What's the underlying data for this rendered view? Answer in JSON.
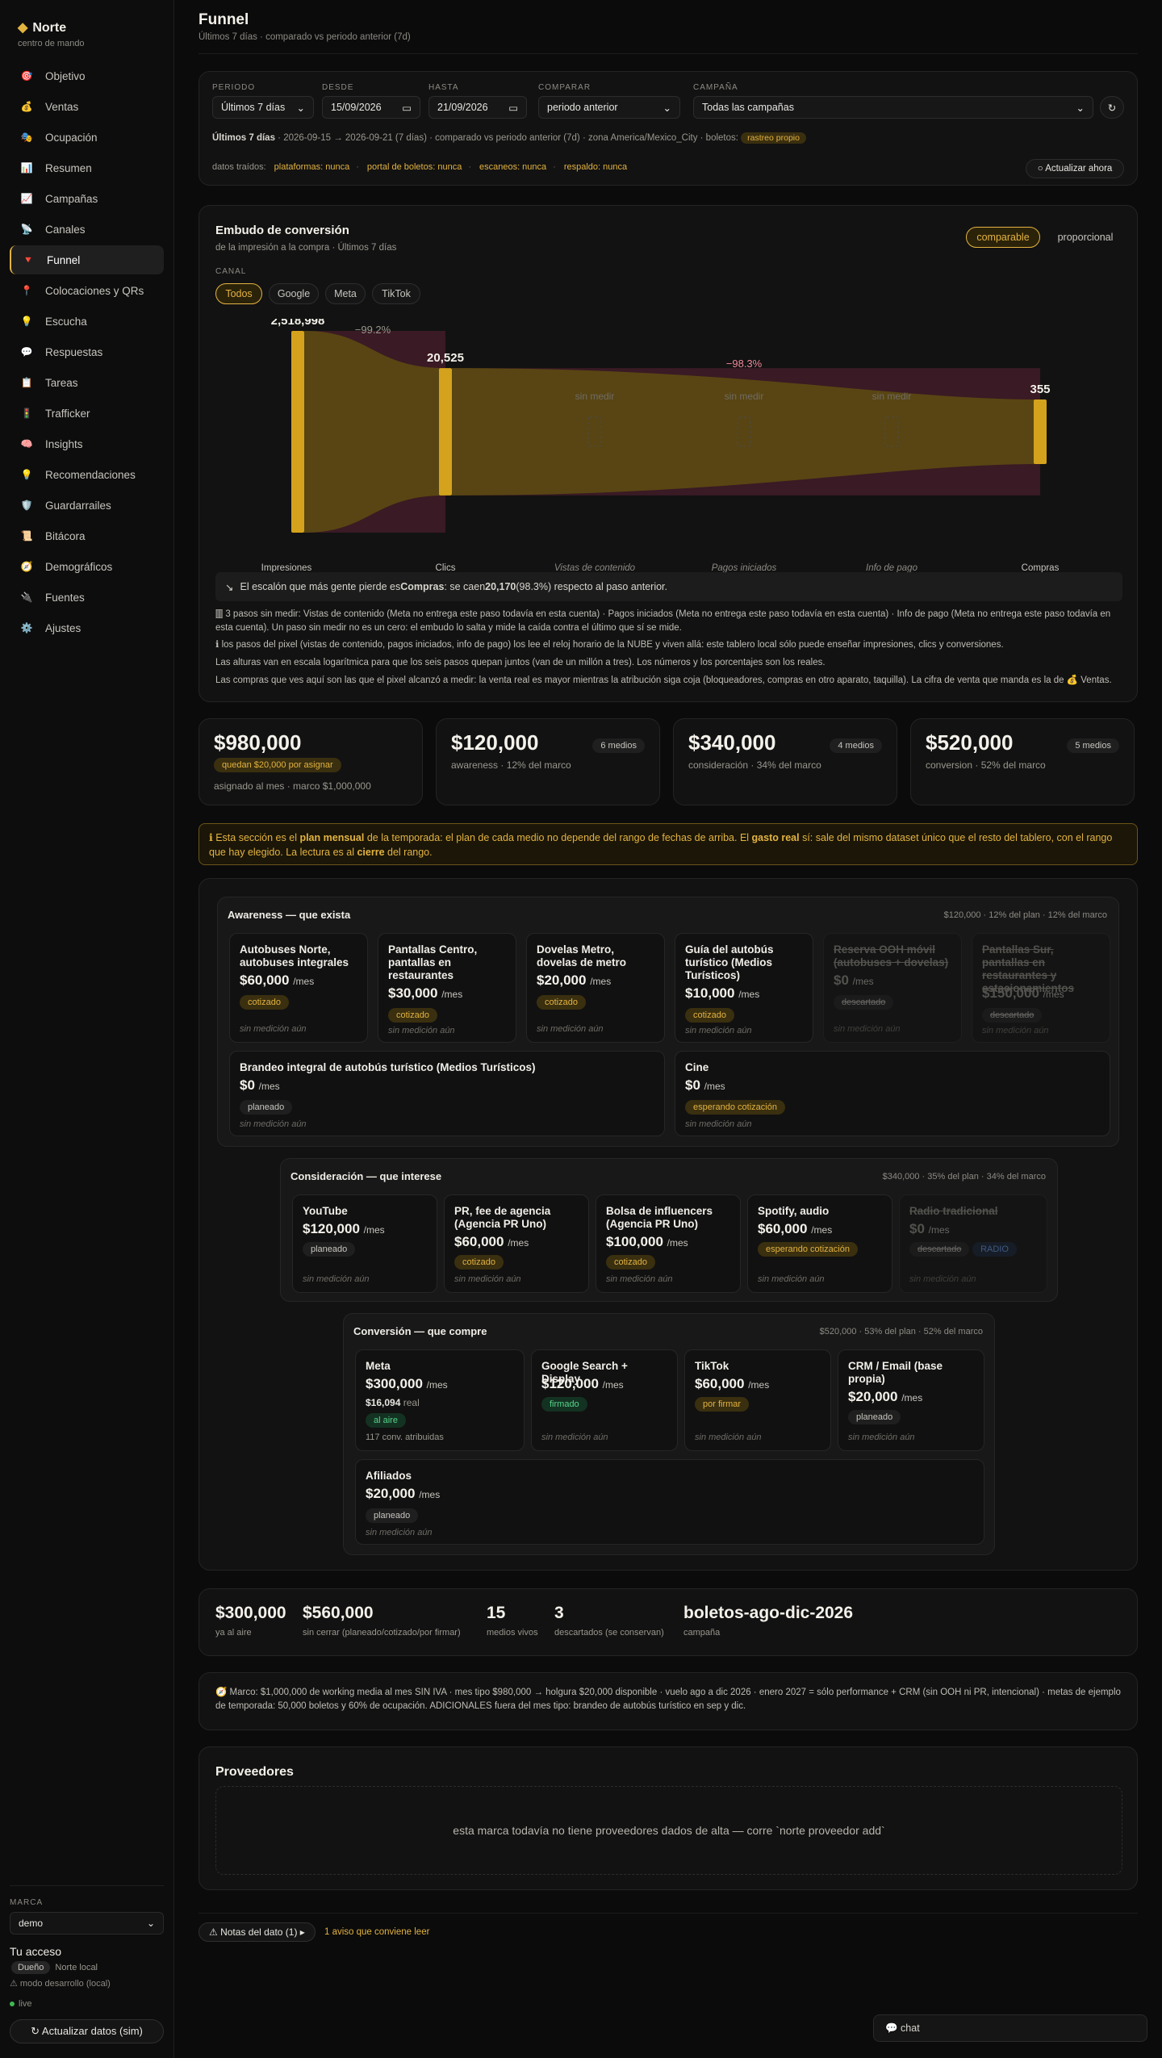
{
  "sidebar": {
    "brand": "Norte",
    "brand_sub": "centro de mando",
    "items": [
      {
        "icon": "🎯",
        "label": "Objetivo"
      },
      {
        "icon": "💰",
        "label": "Ventas"
      },
      {
        "icon": "🎭",
        "label": "Ocupación"
      },
      {
        "icon": "📊",
        "label": "Resumen"
      },
      {
        "icon": "📈",
        "label": "Campañas"
      },
      {
        "icon": "📡",
        "label": "Canales"
      },
      {
        "icon": "🔻",
        "label": "Funnel"
      },
      {
        "icon": "📍",
        "label": "Colocaciones y QRs"
      },
      {
        "icon": "💡",
        "label": "Escucha"
      },
      {
        "icon": "💬",
        "label": "Respuestas"
      },
      {
        "icon": "📋",
        "label": "Tareas"
      },
      {
        "icon": "🚦",
        "label": "Trafficker"
      },
      {
        "icon": "🧠",
        "label": "Insights"
      },
      {
        "icon": "💡",
        "label": "Recomendaciones"
      },
      {
        "icon": "🛡️",
        "label": "Guardarrailes"
      },
      {
        "icon": "📜",
        "label": "Bitácora"
      },
      {
        "icon": "🧭",
        "label": "Demográficos"
      },
      {
        "icon": "🔌",
        "label": "Fuentes"
      },
      {
        "icon": "⚙️",
        "label": "Ajustes"
      }
    ],
    "active": "Funnel",
    "marca_label": "MARCA",
    "marca_value": "demo",
    "acceso_title": "Tu acceso",
    "role": "Dueño",
    "role_name": "Norte local",
    "dev_mode": "⚠ modo desarrollo (local)",
    "live": "live",
    "update_button": "↻ Actualizar datos (sim)"
  },
  "header": {
    "title": "Funnel",
    "subtitle": "Últimos 7 días · comparado vs periodo anterior (7d)"
  },
  "filters": {
    "periodo_label": "PERIODO",
    "periodo": "Últimos 7 días",
    "desde_label": "DESDE",
    "desde": "15/09/2026",
    "hasta_label": "HASTA",
    "hasta": "21/09/2026",
    "comparar_label": "COMPARAR",
    "comparar": "periodo anterior",
    "campana_label": "CAMPAÑA",
    "campana": "Todas las campañas",
    "refresh_icon": "↻",
    "range_strong": "Últimos 7 días",
    "range_text": " · 2026-09-15 → 2026-09-21 (7 días) · comparado vs periodo anterior (7d) · zona America/Mexico_City · boletos:",
    "boletos_chip": "rastreo propio",
    "fetched_label": "datos traídos:",
    "fetched": [
      "plataformas: nunca",
      "portal de boletos: nunca",
      "escaneos: nunca",
      "respaldo: nunca"
    ],
    "update_now": "○ Actualizar ahora"
  },
  "funnel": {
    "title": "Embudo de conversión",
    "subtitle": "de la impresión a la compra · Últimos 7 días",
    "mode_a": "comparable",
    "mode_b": "proporcional",
    "canal_label": "CANAL",
    "channels": [
      "Todos",
      "Google",
      "Meta",
      "TikTok"
    ],
    "active_channel": "Todos",
    "drop1": "−99.2%",
    "drop2": "−98.3%",
    "no_measure": "sin medir",
    "warn": "El escalón que más gente pierde es Compras: se caen 20,170 (98.3%) respecto al paso anterior.",
    "notes": [
      "3 pasos sin medir: Vistas de contenido (Meta no entrega este paso todavía en esta cuenta) · Pagos iniciados (Meta no entrega este paso todavía en esta cuenta) · Info de pago (Meta no entrega este paso todavía en esta cuenta). Un paso sin medir no es un cero: el embudo lo salta y mide la caída contra el último que sí se mide.",
      "ℹ los pasos del pixel (vistas de contenido, pagos iniciados, info de pago) los lee el reloj horario de la NUBE y viven allá: este tablero local sólo puede enseñar impresiones, clics y conversiones.",
      "Las alturas van en escala logarítmica para que los seis pasos quepan juntos (van de un millón a tres). Los números y los porcentajes son los reales.",
      "Las compras que ves aquí son las que el pixel alcanzó a medir: la venta real es mayor mientras la atribución siga coja (bloqueadores, compras en otro aparato, taquilla). La cifra de venta que manda es la de 💰 Ventas."
    ],
    "warn_pre": "El escalón que más gente pierde es ",
    "warn_step": "Compras",
    "warn_mid": ": se caen ",
    "warn_num": "20,170",
    "warn_post": " (98.3%) respecto al paso anterior."
  },
  "chart_data": {
    "type": "funnel",
    "categories": [
      "Impresiones",
      "Clics",
      "Vistas de contenido",
      "Pagos iniciados",
      "Info de pago",
      "Compras"
    ],
    "values": [
      2518998,
      20525,
      null,
      null,
      null,
      355
    ],
    "labels": [
      "2,518,998",
      "20,525",
      "",
      "",
      "",
      "355"
    ],
    "measured": [
      true,
      true,
      false,
      false,
      false,
      true
    ],
    "scale": "log"
  },
  "budget": {
    "total": "$980,000",
    "total_chip": "quedan $20,000 por asignar",
    "total_cap": "asignado al mes · marco $1,000,000",
    "cards": [
      {
        "value": "$120,000",
        "badge": "6 medios",
        "cap": "awareness · 12% del marco"
      },
      {
        "value": "$340,000",
        "badge": "4 medios",
        "cap": "consideración · 34% del marco"
      },
      {
        "value": "$520,000",
        "badge": "5 medios",
        "cap": "conversion · 52% del marco"
      }
    ]
  },
  "info_banner": {
    "a": "ℹ Esta sección es el ",
    "b": "plan mensual",
    "c": " de la temporada: el plan de cada medio no depende del rango de fechas de arriba. El ",
    "d": "gasto real",
    "e": " sí: sale del mismo dataset único que el resto del tablero, con el rango que hay elegido. La lectura es al ",
    "f": "cierre",
    "g": " del rango."
  },
  "groups": {
    "awareness": {
      "title": "Awareness — que exista",
      "stat": "$120,000 · 12% del plan · 12% del marco"
    },
    "consideracion": {
      "title": "Consideración — que interese",
      "stat": "$340,000 · 35% del plan · 34% del marco"
    },
    "conversion": {
      "title": "Conversión — que compre",
      "stat": "$520,000 · 53% del plan · 52% del marco"
    }
  },
  "tiles": {
    "permes": "/mes",
    "no_medicion": "sin medición aún",
    "a1": {
      "name": "Autobuses Norte, autobuses integrales",
      "price": "$60,000",
      "chip": "cotizado"
    },
    "a2": {
      "name": "Pantallas Centro, pantallas en restaurantes",
      "price": "$30,000",
      "chip": "cotizado"
    },
    "a3": {
      "name": "Dovelas Metro, dovelas de metro",
      "price": "$20,000",
      "chip": "cotizado"
    },
    "a4": {
      "name": "Guía del autobús turístico (Medios Turísticos)",
      "price": "$10,000",
      "chip": "cotizado"
    },
    "a5": {
      "name": "Reserva OOH móvil (autobuses + dovelas)",
      "price": "$0",
      "chip": "descartado"
    },
    "a6": {
      "name": "Pantallas Sur, pantallas en restaurantes y estacionamientos",
      "price": "$150,000",
      "chip": "descartado"
    },
    "a7": {
      "name": "Brandeo integral de autobús turístico (Medios Turísticos)",
      "price": "$0",
      "chip": "planeado"
    },
    "a8": {
      "name": "Cine",
      "price": "$0",
      "chip": "esperando cotización"
    },
    "c1": {
      "name": "YouTube",
      "price": "$120,000",
      "chip": "planeado"
    },
    "c2": {
      "name": "PR, fee de agencia (Agencia PR Uno)",
      "price": "$60,000",
      "chip": "cotizado"
    },
    "c3": {
      "name": "Bolsa de influencers (Agencia PR Uno)",
      "price": "$100,000",
      "chip": "cotizado"
    },
    "c4": {
      "name": "Spotify, audio",
      "price": "$60,000",
      "chip": "esperando cotización"
    },
    "c5": {
      "name": "Radio tradicional",
      "price": "$0",
      "chip": "descartado",
      "chip2": "RADIO"
    },
    "v1": {
      "name": "Meta",
      "price": "$300,000",
      "real": "$16,094",
      "real_lbl": "real",
      "chip": "al aire",
      "conv": "117 conv. atribuidas"
    },
    "v2": {
      "name": "Google Search + Display",
      "price": "$120,000",
      "chip": "firmado"
    },
    "v3": {
      "name": "TikTok",
      "price": "$60,000",
      "chip": "por firmar"
    },
    "v4": {
      "name": "CRM / Email (base propia)",
      "price": "$20,000",
      "chip": "planeado"
    },
    "v5": {
      "name": "Afiliados",
      "price": "$20,000",
      "chip": "planeado"
    }
  },
  "summary": [
    {
      "value": "$300,000",
      "cap": "ya al aire"
    },
    {
      "value": "$560,000",
      "cap": "sin cerrar (planeado/cotizado/por firmar)"
    },
    {
      "value": "15",
      "cap": "medios vivos"
    },
    {
      "value": "3",
      "cap": "descartados (se conservan)"
    },
    {
      "value": "boletos-ago-dic-2026",
      "cap": "campaña"
    }
  ],
  "marco_note": "🧭 Marco: $1,000,000 de working media al mes SIN IVA · mes tipo $980,000 → holgura $20,000 disponible · vuelo ago a dic 2026 · enero 2027 = sólo performance + CRM (sin OOH ni PR, intencional) · metas de ejemplo de temporada: 50,000 boletos y 60% de ocupación. ADICIONALES fuera del mes tipo: brandeo de autobús turístico en sep y dic.",
  "providers": {
    "title": "Proveedores",
    "empty": "esta marca todavía no tiene proveedores dados de alta — corre `norte proveedor add`"
  },
  "footer": {
    "notes_btn": "⚠ Notas del dato (1) ▸",
    "notes_warn": "1 aviso que conviene leer",
    "chat": "💬 chat"
  },
  "colors": {
    "accent": "#e3b341",
    "bg": "#0b0b0b",
    "card": "#121212",
    "funnel_fill": "#5c4a12",
    "funnel_drop": "#3a1a24"
  }
}
